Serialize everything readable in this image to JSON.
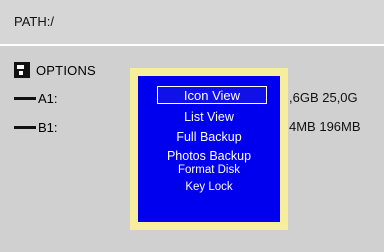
{
  "path": {
    "label": "PATH:/"
  },
  "options": {
    "label": "OPTIONS",
    "icon": "options-icon"
  },
  "drives": [
    {
      "label": "A1:",
      "size": ",6GB 25,0G"
    },
    {
      "label": "B1:",
      "size": "4MB 196MB"
    }
  ],
  "menu": {
    "items": [
      {
        "label": "Icon View",
        "selected": true
      },
      {
        "label": "List  View",
        "selected": false
      },
      {
        "label": "Full Backup",
        "selected": false
      },
      {
        "label": "Photos Backup",
        "selected": false
      },
      {
        "label": "Format Disk",
        "selected": false
      },
      {
        "label": "Key Lock",
        "selected": false
      }
    ]
  },
  "colors": {
    "background": "#d0d0d0",
    "menu_frame": "#f6ee9c",
    "menu_panel": "#0000ee",
    "menu_text": "#ffffff"
  }
}
